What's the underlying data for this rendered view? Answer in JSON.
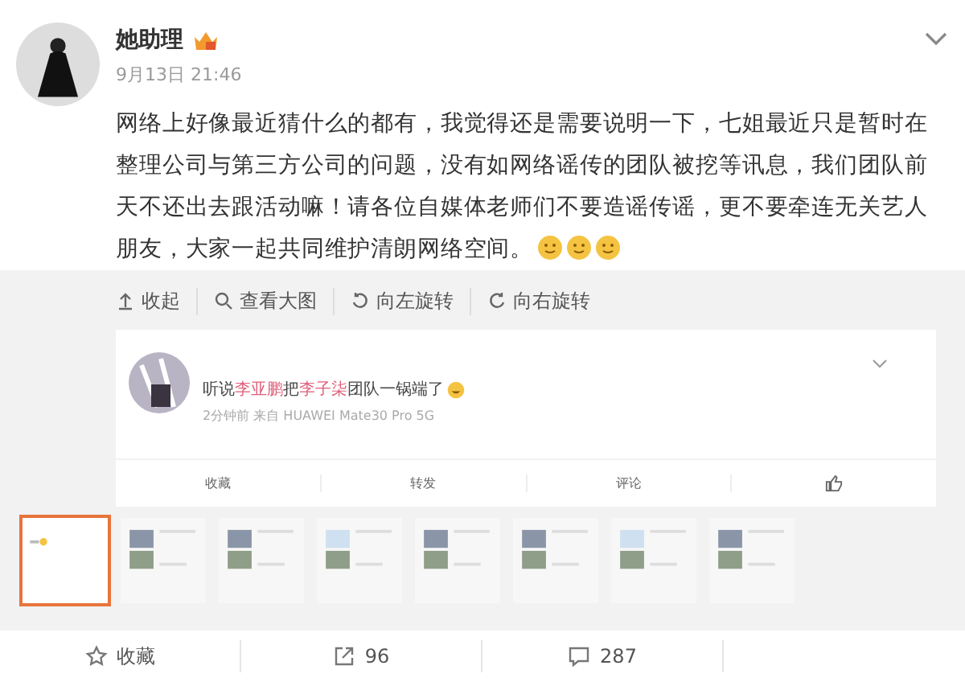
{
  "post": {
    "author": "她助理",
    "time": "9月13日 21:46",
    "text": "网络上好像最近猜什么的都有，我觉得还是需要说明一下，七姐最近只是暂时在整理公司与第三方公司的问题，没有如网络谣传的团队被挖等讯息，我们团队前天不还出去跟活动嘛！请各位自媒体老师们不要造谣传谣，更不要牵连无关艺人朋友，大家一起共同维护清朗网络空间。",
    "emojis": [
      {
        "kind": "smile"
      },
      {
        "kind": "smile"
      },
      {
        "kind": "smile"
      }
    ]
  },
  "image_toolbar": [
    {
      "kind": "collapse",
      "label": "收起"
    },
    {
      "kind": "zoom",
      "label": "查看大图"
    },
    {
      "kind": "rotate_left",
      "label": "向左旋转"
    },
    {
      "kind": "rotate_right",
      "label": "向右旋转"
    }
  ],
  "quoted_screenshot": {
    "parts": [
      {
        "text": "听说",
        "highlight": false
      },
      {
        "text": "李亚鹏",
        "highlight": true
      },
      {
        "text": "把",
        "highlight": false
      },
      {
        "text": "李子柒",
        "highlight": true
      },
      {
        "text": "团队一锅端了",
        "highlight": false
      }
    ],
    "meta": "2分钟前  来自 HUAWEI Mate30 Pro 5G",
    "actions": [
      {
        "kind": "text",
        "label": "收藏"
      },
      {
        "kind": "text",
        "label": "转发"
      },
      {
        "kind": "text",
        "label": "评论"
      },
      {
        "kind": "like"
      }
    ]
  },
  "thumbnails": [
    {
      "selected": true
    },
    {
      "selected": false
    },
    {
      "selected": false
    },
    {
      "selected": false
    },
    {
      "selected": false
    },
    {
      "selected": false
    },
    {
      "selected": false
    },
    {
      "selected": false
    }
  ],
  "footer": [
    {
      "kind": "favorite",
      "label": "收藏"
    },
    {
      "kind": "repost",
      "label": "96"
    },
    {
      "kind": "comment",
      "label": "287"
    }
  ]
}
